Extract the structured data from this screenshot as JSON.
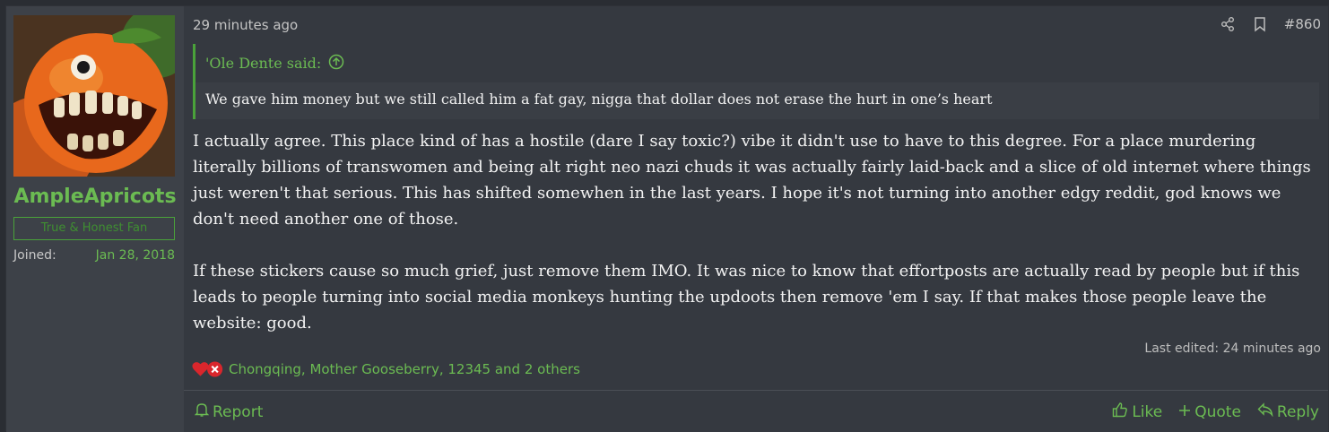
{
  "user": {
    "username": "AmpleApricots",
    "title": "True & Honest Fan",
    "joined_label": "Joined:",
    "joined_date": "Jan 28, 2018",
    "avatar_icon": "apricot-monster-avatar"
  },
  "post": {
    "timestamp": "29 minutes ago",
    "number": "#860",
    "quote": {
      "author": "'Ole Dente said:",
      "text": "We gave him money but we still called him a fat gay, nigga that dollar does not erase the hurt in one’s heart"
    },
    "paragraphs": [
      "I actually agree. This place kind of has a hostile (dare I say toxic?) vibe it didn't use to have to this degree. For a place murdering literally billions of transwomen and being alt right neo nazi chuds it was actually fairly laid-back and a slice of old internet where things just weren't that serious. This has shifted somewhen in the last years. I hope it's not turning into another edgy reddit, god knows we don't need another one of those.",
      "If these stickers cause so much grief, just remove them IMO. It was nice to know that effortposts are actually read by people but if this leads to people turning into social media monkeys hunting the updoots then remove 'em I say. If that makes those people leave the website: good."
    ],
    "last_edited": "Last edited: 24 minutes ago",
    "reactions_text": "Chongqing, Mother Gooseberry, 12345 and 2 others"
  },
  "footer": {
    "report": "Report",
    "like": "Like",
    "quote": "Quote",
    "reply": "Reply"
  },
  "colors": {
    "accent": "#6bbb52",
    "background": "#353940",
    "user_cell": "#3d4148"
  }
}
